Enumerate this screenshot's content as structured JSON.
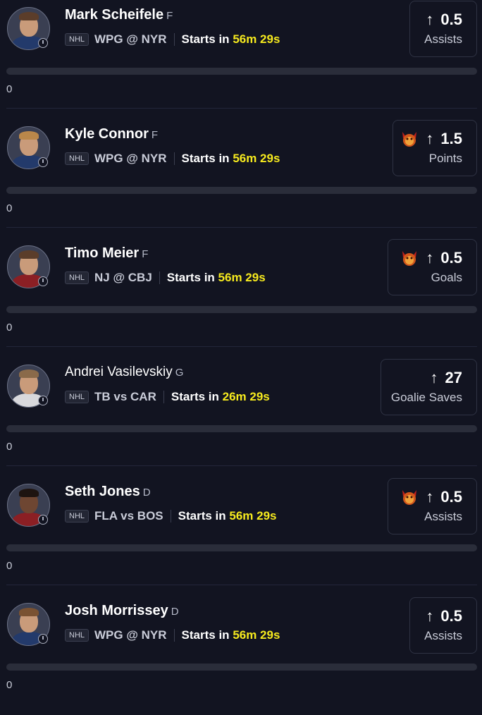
{
  "props": [
    {
      "player": "Mark Scheifele",
      "position": "F",
      "league": "NHL",
      "matchup": "WPG @ NYR",
      "starts_label": "Starts in",
      "countdown": "56m 29s",
      "line": "0.5",
      "stat": "Assists",
      "demon": false,
      "count": "0",
      "progress": 0
    },
    {
      "player": "Kyle Connor",
      "position": "F",
      "league": "NHL",
      "matchup": "WPG @ NYR",
      "starts_label": "Starts in",
      "countdown": "56m 29s",
      "line": "1.5",
      "stat": "Points",
      "demon": true,
      "count": "0",
      "progress": 0
    },
    {
      "player": "Timo Meier",
      "position": "F",
      "league": "NHL",
      "matchup": "NJ @ CBJ",
      "starts_label": "Starts in",
      "countdown": "56m 29s",
      "line": "0.5",
      "stat": "Goals",
      "demon": true,
      "count": "0",
      "progress": 0
    },
    {
      "player": "Andrei Vasilevskiy",
      "position": "G",
      "league": "NHL",
      "matchup": "TB vs CAR",
      "starts_label": "Starts in",
      "countdown": "26m 29s",
      "line": "27",
      "stat": "Goalie Saves",
      "demon": false,
      "count": "0",
      "progress": 0
    },
    {
      "player": "Seth Jones",
      "position": "D",
      "league": "NHL",
      "matchup": "FLA vs BOS",
      "starts_label": "Starts in",
      "countdown": "56m 29s",
      "line": "0.5",
      "stat": "Assists",
      "demon": true,
      "count": "0",
      "progress": 0
    },
    {
      "player": "Josh Morrissey",
      "position": "D",
      "league": "NHL",
      "matchup": "WPG @ NYR",
      "starts_label": "Starts in",
      "countdown": "56m 29s",
      "line": "0.5",
      "stat": "Assists",
      "demon": false,
      "count": "0",
      "progress": 0
    }
  ],
  "icons": {
    "direction": "arrow-up-icon",
    "boost": "demon-icon",
    "status": "clock-icon"
  },
  "colors": {
    "background": "#121421",
    "countdown": "#f6ea1e",
    "progress_track": "#2a2d3a"
  }
}
